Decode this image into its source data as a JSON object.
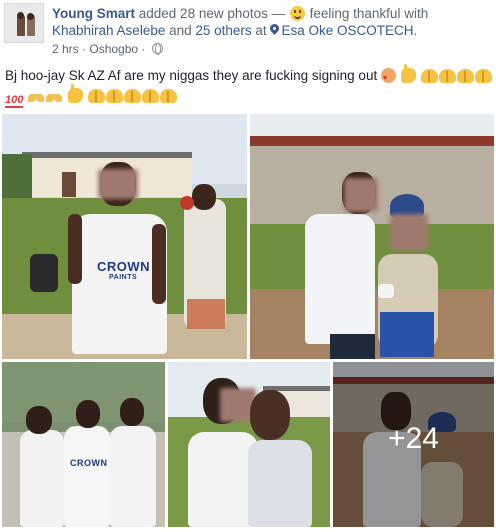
{
  "post": {
    "author_name": "Young Smart",
    "action_text": " added 28 new photos — ",
    "feeling_icon": "smile-emoji-icon",
    "feeling_text": " feeling thankful with ",
    "tagged_name": "Khabhirah Aselebe",
    "and_text": " and ",
    "others_text": "25 others",
    "at_text": " at ",
    "location": "Esa Oke OSCOTECH",
    "location_suffix": ".",
    "time": "2 hrs",
    "separator": " · ",
    "place": "Oshogbo",
    "place_separator": " · ",
    "privacy_icon": "globe-icon",
    "status_text": "Bj hoo-jay Sk AZ Af are my niggas they are fucking signing out",
    "status_emoji_line1": [
      "heart-eyes-face",
      "pointing-hand",
      "raised-hands",
      "raised-hands",
      "raised-hands",
      "raised-hands"
    ],
    "status_emoji_line2": [
      "hundred-points",
      "ribbon",
      "ribbon",
      "pointing-hand",
      "raised-hands",
      "raised-hands",
      "raised-hands",
      "raised-hands",
      "raised-hands"
    ]
  },
  "photos": {
    "count": 5,
    "overlay_more_label": "+24",
    "shirt_text": "CROWN",
    "shirt_subtext": "PAINTS"
  },
  "colors": {
    "link_blue": "#385898",
    "meta_gray": "#606770",
    "text_dark": "#1d2129"
  }
}
